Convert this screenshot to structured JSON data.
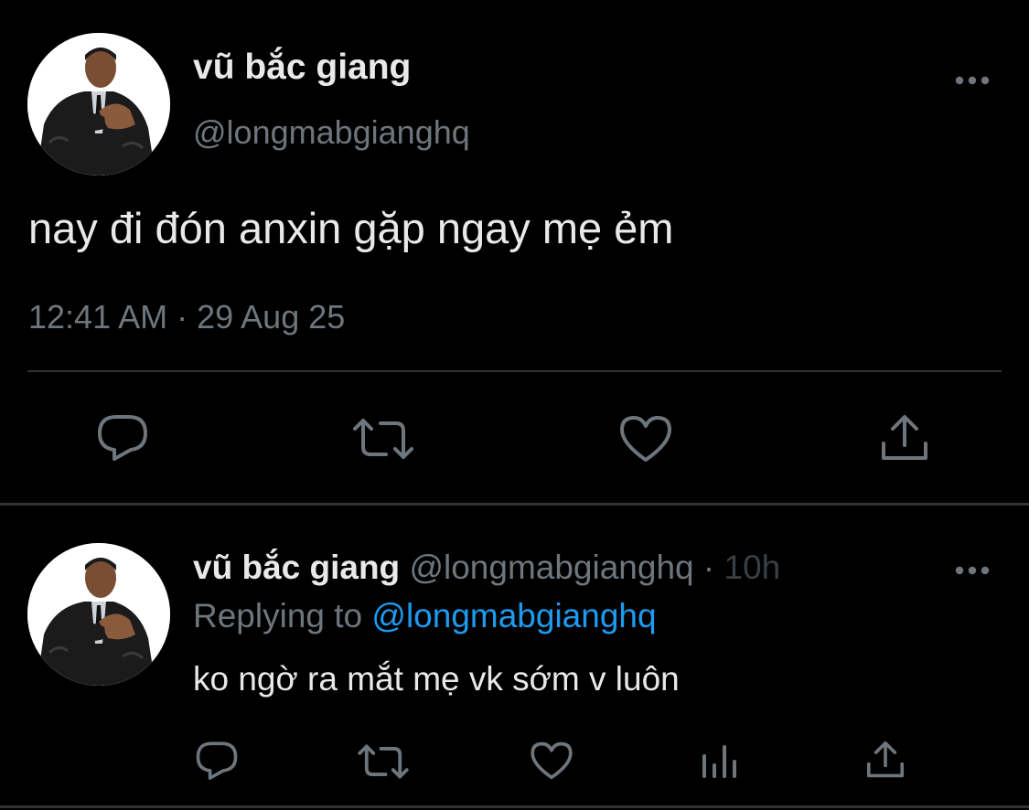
{
  "main_tweet": {
    "author_name": "vũ bắc giang",
    "author_handle": "@longmabgianghq",
    "text": "nay đi đón anxin gặp ngay mẹ ẻm",
    "timestamp": "12:41 AM · 29 Aug 25",
    "more_icon": "more-horizontal-icon",
    "actions": [
      "reply-icon",
      "retweet-icon",
      "like-icon",
      "share-icon"
    ]
  },
  "reply_tweet": {
    "author_name": "vũ bắc giang",
    "author_handle": "@longmabgianghq",
    "separator": "·",
    "age": "10h",
    "replying_prefix": "Replying to",
    "replying_handle": "@longmabgianghq",
    "text": "ko ngờ ra mắt mẹ vk sớm v luôn",
    "more_icon": "more-horizontal-icon",
    "actions": [
      "reply-icon",
      "retweet-icon",
      "like-icon",
      "analytics-icon",
      "share-icon"
    ]
  },
  "colors": {
    "background": "#000000",
    "primary_text": "#e7e9ea",
    "secondary_text": "#6e767d",
    "link": "#1d9bf0",
    "divider": "#2f3336"
  }
}
